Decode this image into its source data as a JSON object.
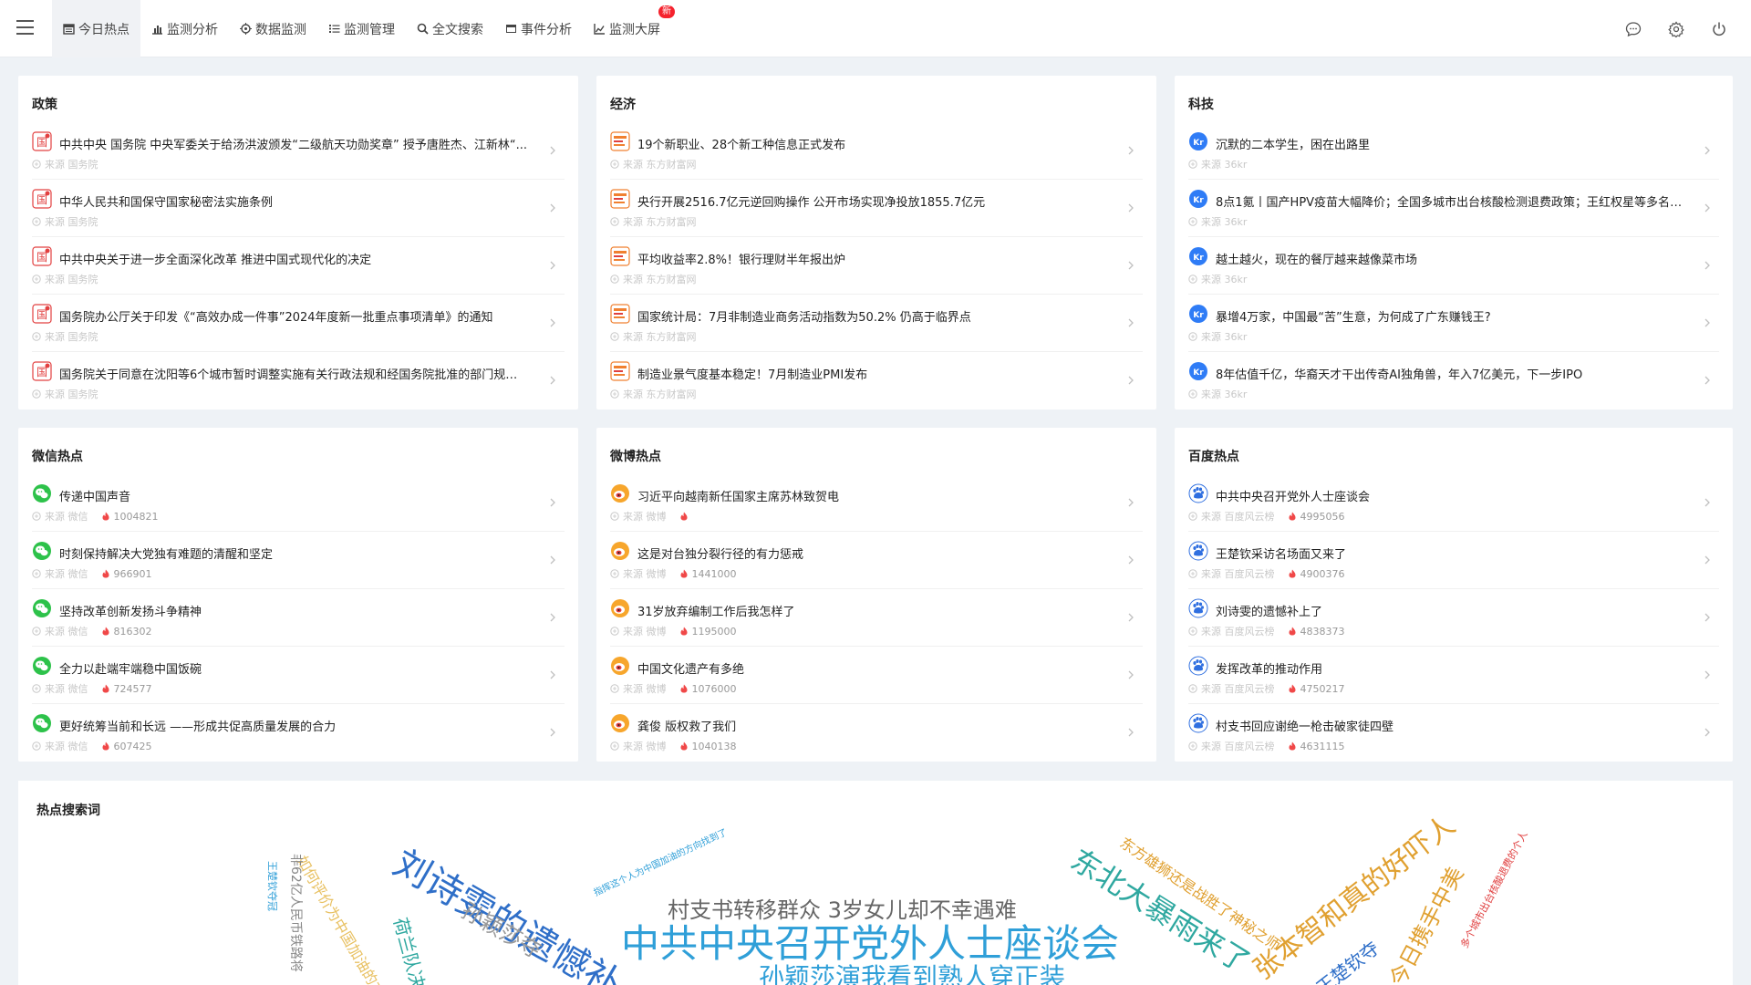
{
  "nav": {
    "items": [
      {
        "label": "今日热点",
        "icon": "calendar-icon"
      },
      {
        "label": "监测分析",
        "icon": "bar-chart-icon"
      },
      {
        "label": "数据监测",
        "icon": "target-icon"
      },
      {
        "label": "监测管理",
        "icon": "list-icon"
      },
      {
        "label": "全文搜索",
        "icon": "search-icon"
      },
      {
        "label": "事件分析",
        "icon": "folder-icon"
      },
      {
        "label": "监测大屏",
        "icon": "line-chart-icon"
      }
    ],
    "badge": "新"
  },
  "cards": {
    "policy": {
      "title": "政策",
      "items": [
        {
          "title": "中共中央 国务院 中央军委关于给汤洪波颁发“二级航天功勋奖章” 授予唐胜杰、江新林“...",
          "source": "来源 国务院"
        },
        {
          "title": "中华人民共和国保守国家秘密法实施条例",
          "source": "来源 国务院"
        },
        {
          "title": "中共中央关于进一步全面深化改革 推进中国式现代化的决定",
          "source": "来源 国务院"
        },
        {
          "title": "国务院办公厅关于印发《“高效办成一件事”2024年度新一批重点事项清单》的通知",
          "source": "来源 国务院"
        },
        {
          "title": "国务院关于同意在沈阳等6个城市暂时调整实施有关行政法规和经国务院批准的部门规章...",
          "source": "来源 国务院"
        }
      ]
    },
    "economy": {
      "title": "经济",
      "items": [
        {
          "title": "19个新职业、28个新工种信息正式发布",
          "source": "来源 东方财富网"
        },
        {
          "title": "央行开展2516.7亿元逆回购操作 公开市场实现净投放1855.7亿元",
          "source": "来源 东方财富网"
        },
        {
          "title": "平均收益率2.8%！银行理财半年报出炉",
          "source": "来源 东方财富网"
        },
        {
          "title": "国家统计局：7月非制造业商务活动指数为50.2% 仍高于临界点",
          "source": "来源 东方财富网"
        },
        {
          "title": "制造业景气度基本稳定！7月制造业PMI发布",
          "source": "来源 东方财富网"
        }
      ]
    },
    "tech": {
      "title": "科技",
      "items": [
        {
          "title": "沉默的二本学生，困在出路里",
          "source": "来源 36kr"
        },
        {
          "title": "8点1氪丨国产HPV疫苗大幅降价；全国多城市出台核酸检测退费政策；王红权星等多名百...",
          "source": "来源 36kr"
        },
        {
          "title": "越土越火，现在的餐厅越来越像菜市场",
          "source": "来源 36kr"
        },
        {
          "title": "暴增4万家，中国最“苦”生意，为何成了广东赚钱王?",
          "source": "来源 36kr"
        },
        {
          "title": "8年估值千亿，华裔天才干出传奇AI独角兽，年入7亿美元，下一步IPO",
          "source": "来源 36kr"
        }
      ]
    },
    "wechat": {
      "title": "微信热点",
      "items": [
        {
          "title": "传递中国声音",
          "source": "来源 微信",
          "heat": "1004821"
        },
        {
          "title": "时刻保持解决大党独有难题的清醒和坚定",
          "source": "来源 微信",
          "heat": "966901"
        },
        {
          "title": "坚持改革创新发扬斗争精神",
          "source": "来源 微信",
          "heat": "816302"
        },
        {
          "title": "全力以赴端牢端稳中国饭碗",
          "source": "来源 微信",
          "heat": "724577"
        },
        {
          "title": "更好统筹当前和长远 ——形成共促高质量发展的合力",
          "source": "来源 微信",
          "heat": "607425"
        }
      ]
    },
    "weibo": {
      "title": "微博热点",
      "items": [
        {
          "title": "习近平向越南新任国家主席苏林致贺电",
          "source": "来源 微博",
          "heat": ""
        },
        {
          "title": "这是对台独分裂行径的有力惩戒",
          "source": "来源 微博",
          "heat": "1441000"
        },
        {
          "title": "31岁放弃编制工作后我怎样了",
          "source": "来源 微博",
          "heat": "1195000"
        },
        {
          "title": "中国文化遗产有多绝",
          "source": "来源 微博",
          "heat": "1076000"
        },
        {
          "title": "龚俊 版权救了我们",
          "source": "来源 微博",
          "heat": "1040138"
        }
      ]
    },
    "baidu": {
      "title": "百度热点",
      "items": [
        {
          "title": "中共中央召开党外人士座谈会",
          "source": "来源 百度风云榜",
          "heat": "4995056"
        },
        {
          "title": "王楚钦采访名场面又来了",
          "source": "来源 百度风云榜",
          "heat": "4900376"
        },
        {
          "title": "刘诗雯的遗憾补上了",
          "source": "来源 百度风云榜",
          "heat": "4838373"
        },
        {
          "title": "发挥改革的推动作用",
          "source": "来源 百度风云榜",
          "heat": "4750217"
        },
        {
          "title": "村支书回应谢绝一枪击破家徒四壁",
          "source": "来源 百度风云榜",
          "heat": "4631115"
        }
      ]
    }
  },
  "wordcloud": {
    "title": "热点搜索词",
    "words": [
      {
        "text": "中共中央召开党外人士座谈会",
        "color": "#2f9fd8"
      },
      {
        "text": "村支书转移群众 3岁女儿却不幸遇难",
        "color": "#666666"
      },
      {
        "text": "孙颖莎演我看到熟人穿正装",
        "color": "#2f9fd8"
      },
      {
        "text": "刘诗雯的遗憾补",
        "color": "#2f6fc8"
      },
      {
        "text": "孙颖莎夺",
        "color": "#999999"
      },
      {
        "text": "荷兰队决",
        "color": "#2fa8a0"
      },
      {
        "text": "东北大暴雨来了",
        "color": "#2fa8a0"
      },
      {
        "text": "东方雄狮还是战胜了神秘之师",
        "color": "#e0a030"
      },
      {
        "text": "张本智和真的好吓人",
        "color": "#e0a030"
      },
      {
        "text": "王楚钦夺",
        "color": "#2f6fc8"
      },
      {
        "text": "今日携手中美",
        "color": "#e0a030"
      },
      {
        "text": "指挥这个人为中国加油的方向找到了",
        "color": "#2f9fd8"
      },
      {
        "text": "如何评价为中国加油的方向",
        "color": "#e8c060"
      },
      {
        "text": "非62亿人民币铁路将",
        "color": "#888888"
      },
      {
        "text": "多个城市出台核酸退费的个人",
        "color": "#e04040"
      },
      {
        "text": "王楚钦夺冠",
        "color": "#2f9fd8"
      }
    ]
  }
}
